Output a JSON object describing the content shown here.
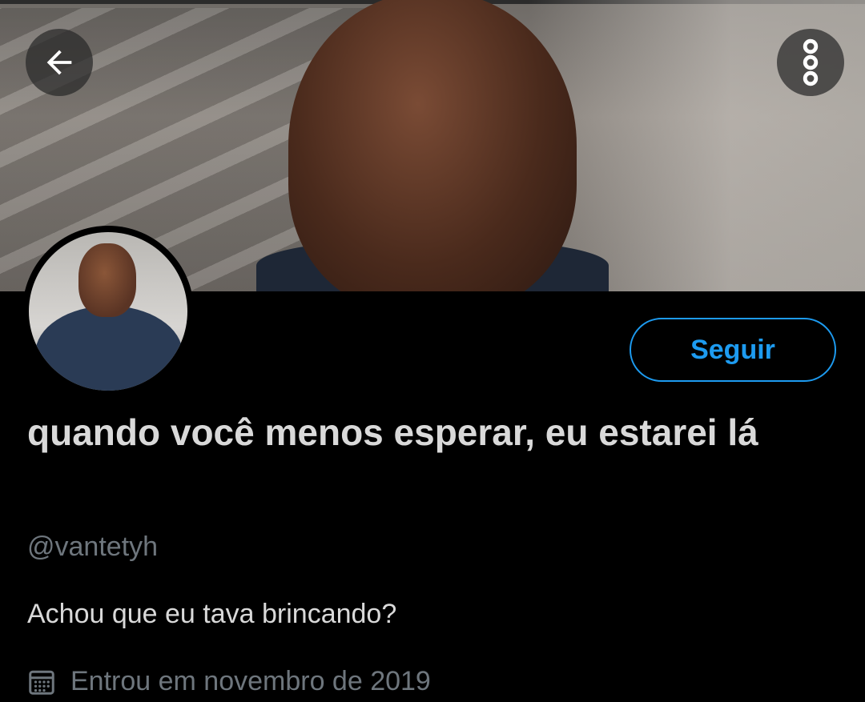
{
  "colors": {
    "background": "#000000",
    "accent": "#1d9bf0",
    "primary_text": "#d9d9d9",
    "secondary_text": "#6e767d"
  },
  "header": {
    "back_icon": "arrow-left-icon",
    "more_icon": "more-vertical-icon"
  },
  "profile": {
    "display_name": "quando você menos esperar, eu estarei lá",
    "handle": "@vantetyh",
    "bio": "Achou que eu tava brincando?",
    "joined_icon": "calendar-icon",
    "joined": "Entrou em novembro de 2019",
    "follow_label": "Seguir"
  }
}
